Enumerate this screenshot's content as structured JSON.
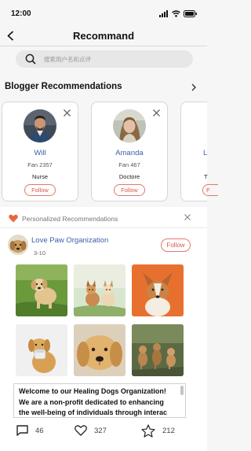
{
  "status_bar": {
    "time": "12:00"
  },
  "nav": {
    "title": "Recommand"
  },
  "search": {
    "placeholder": "搜索用户名和点评"
  },
  "blogger_section": {
    "title": "Blogger Recommendations",
    "cards": [
      {
        "name": "Will",
        "fans": "Fan 2357",
        "role": "Nurse",
        "follow_label": "Follow"
      },
      {
        "name": "Amanda",
        "fans": "Fan 467",
        "role": "Doctore",
        "follow_label": "Follow"
      },
      {
        "name": "L",
        "fans": "",
        "role": "T",
        "follow_label": "F"
      }
    ]
  },
  "feed": {
    "section_label": "Personalized Recommendations",
    "post": {
      "author": "Love Paw Organization",
      "date": "3-10",
      "follow_label": "Follow",
      "text_lines": [
        "Welcome to our Healing Dogs Organization!",
        "We are a non-profit dedicated to enhancing",
        "the well-being of individuals through interac"
      ],
      "comments": "46",
      "likes": "327",
      "stars": "212"
    }
  },
  "icons": {
    "back": "chevron-left-icon",
    "search": "search-icon",
    "arrow": "chevron-right-icon",
    "close": "close-icon",
    "heart": "heart-icon",
    "comment": "comment-icon",
    "like": "heart-outline-icon",
    "star": "star-outline-icon"
  },
  "colors": {
    "accent": "#d9574a",
    "link": "#3b5fa8",
    "heart": "#e8663c"
  }
}
